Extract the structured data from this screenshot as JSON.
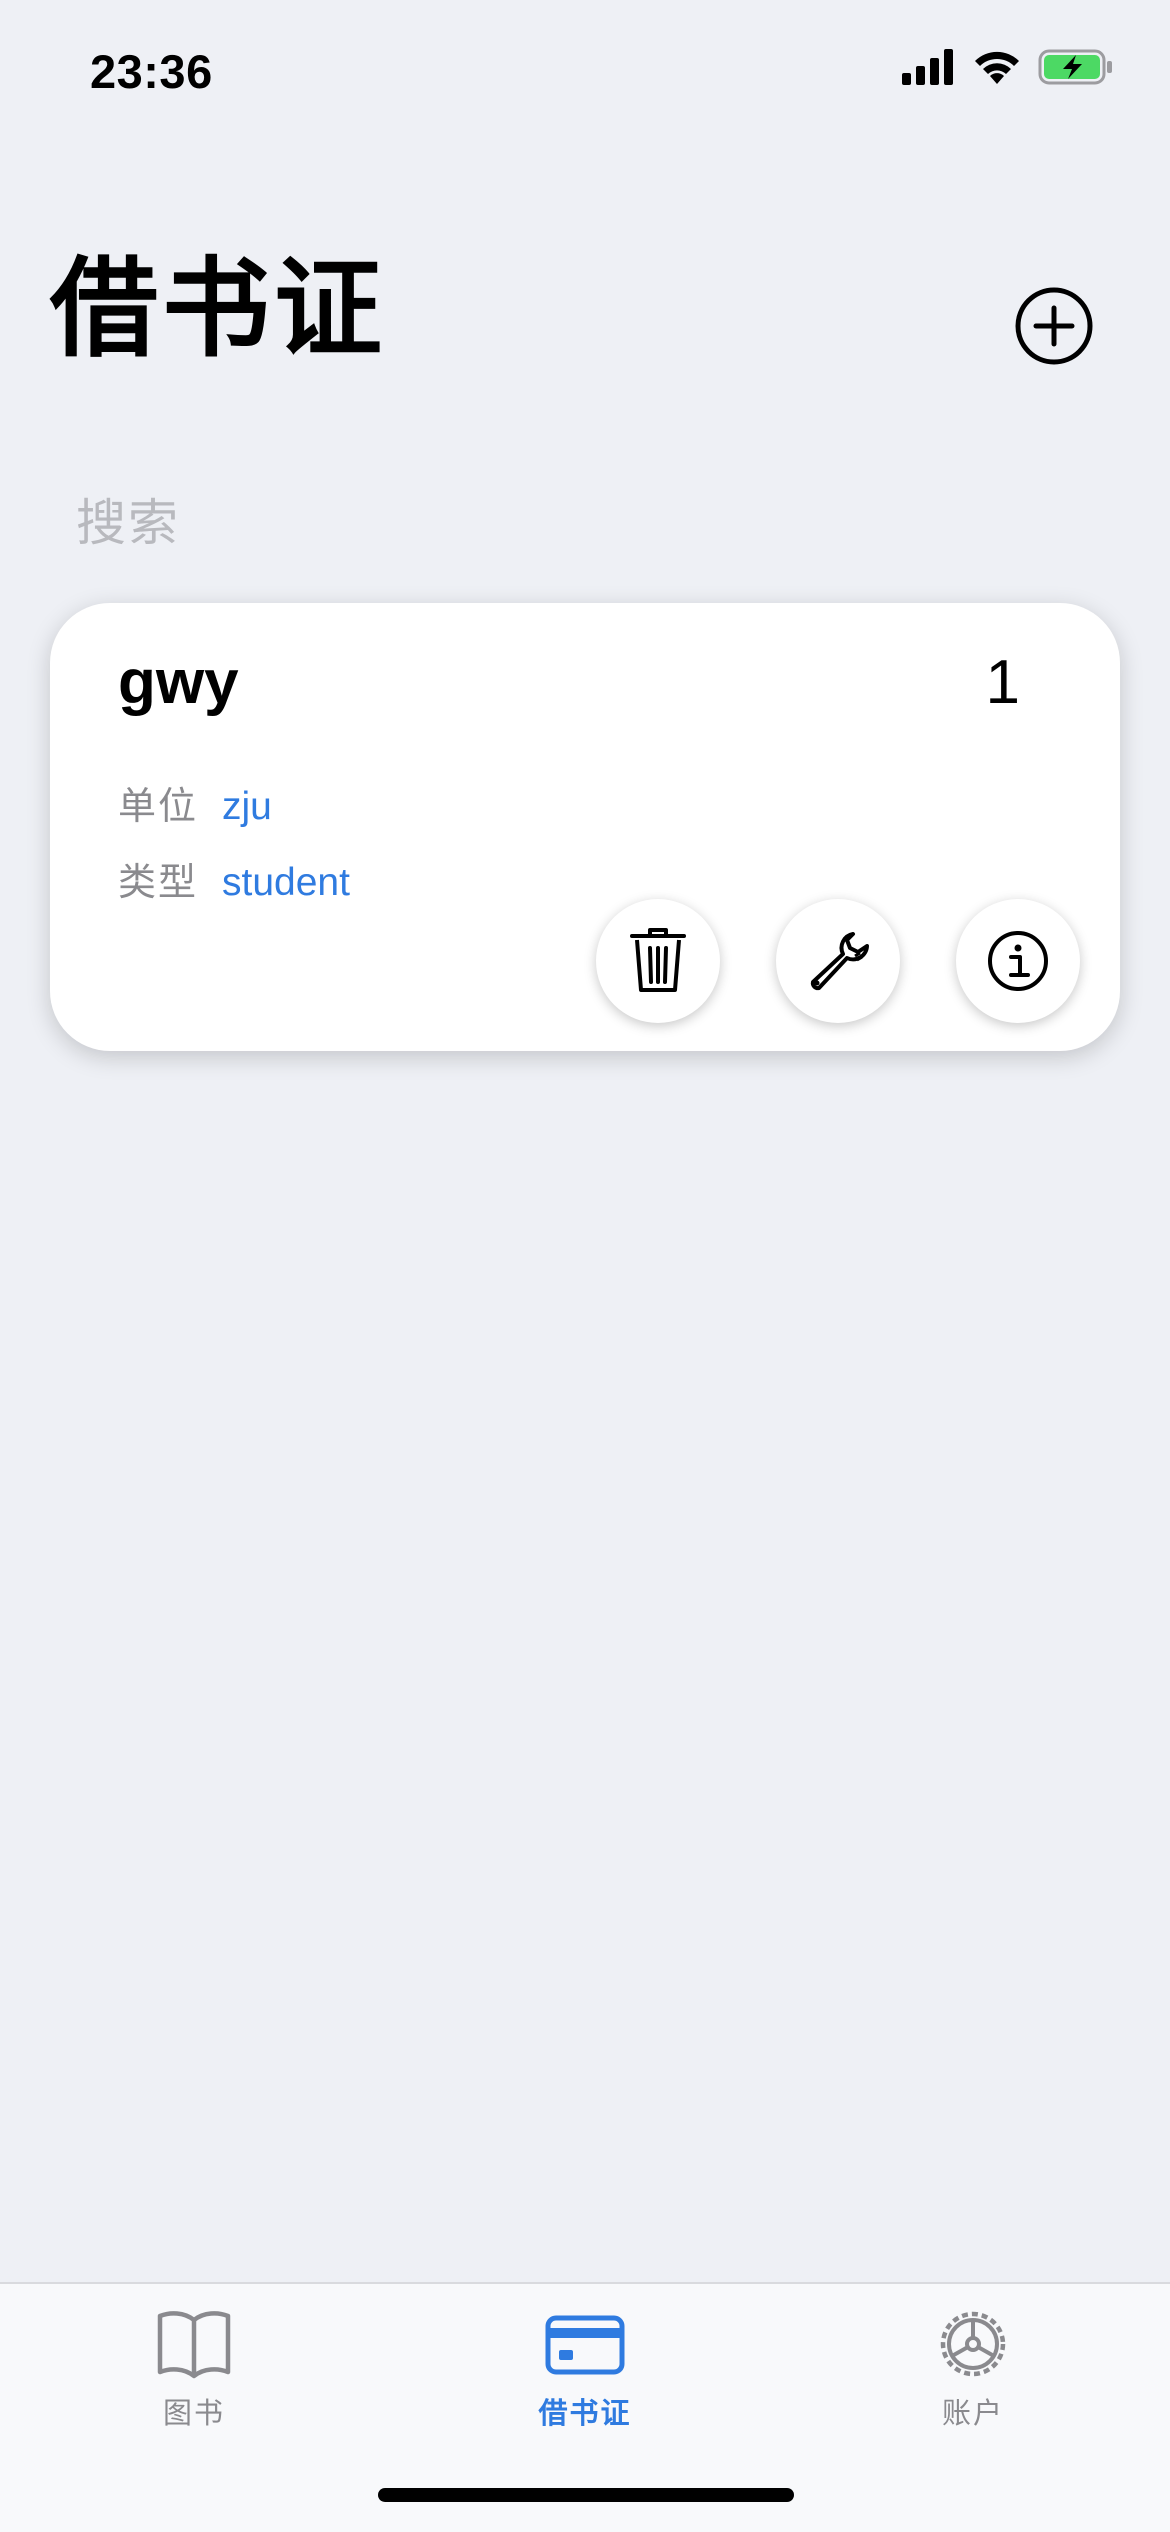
{
  "status_bar": {
    "time": "23:36"
  },
  "header": {
    "title": "借书证"
  },
  "search": {
    "placeholder": "搜索"
  },
  "cards": [
    {
      "name": "gwy",
      "count": "1",
      "fields": [
        {
          "label": "单位",
          "value": "zju"
        },
        {
          "label": "类型",
          "value": "student"
        }
      ],
      "actions": [
        "trash-icon",
        "wrench-icon",
        "info-icon"
      ]
    }
  ],
  "tab_bar": {
    "items": [
      {
        "label": "图书",
        "icon": "book-icon",
        "active": false
      },
      {
        "label": "借书证",
        "icon": "card-icon",
        "active": true
      },
      {
        "label": "账户",
        "icon": "gear-icon",
        "active": false
      }
    ]
  },
  "colors": {
    "accent": "#2f7be0",
    "background": "#eef0f5",
    "battery": "#4cd964"
  }
}
